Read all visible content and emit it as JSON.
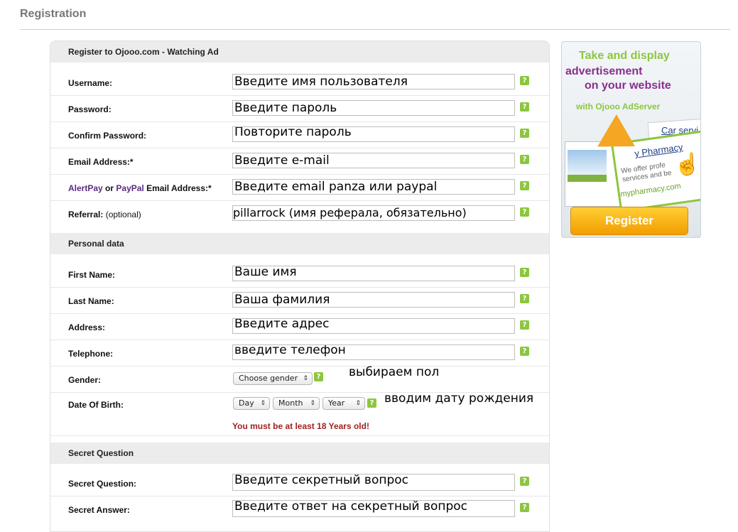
{
  "page": {
    "title": "Registration"
  },
  "form": {
    "header": "Register to Ojooo.com - Watching Ad",
    "account": {
      "username": {
        "label": "Username:",
        "value": "Введите имя пользователя"
      },
      "password": {
        "label": "Password:",
        "value": "Введите пароль"
      },
      "confirm_password": {
        "label": "Confirm Password:",
        "value": "Повторите пароль"
      },
      "email": {
        "label": "Email Address:*",
        "value": "Введите e-mail"
      },
      "pay_email": {
        "alertpay": "AlertPay",
        "or": "or",
        "paypal": "PayPal",
        "rest": "Email Address:*",
        "value": "Введите email panza или paypal"
      },
      "referral": {
        "label": "Referral:",
        "optional": "(optional)",
        "value": "pillarrock (имя реферала, обязательно)"
      }
    },
    "personal": {
      "header": "Personal data",
      "first_name": {
        "label": "First Name:",
        "value": "Ваше имя"
      },
      "last_name": {
        "label": "Last Name:",
        "value": "Ваша фамилия"
      },
      "address": {
        "label": "Address:",
        "value": "Введите адрес"
      },
      "telephone": {
        "label": "Telephone:",
        "value": "введите телефон"
      },
      "gender": {
        "label": "Gender:",
        "selected": "Choose gender",
        "note": "выбираем пол"
      },
      "dob": {
        "label": "Date Of Birth:",
        "day": "Day",
        "month": "Month",
        "year": "Year",
        "note": "вводим дату рождения",
        "error": "You must be at least 18 Years old!"
      }
    },
    "secret": {
      "header": "Secret Question",
      "question": {
        "label": "Secret Question:",
        "value": "Введите секретный вопрос"
      },
      "answer": {
        "label": "Secret Answer:",
        "value": "Введите ответ на секретный вопрос"
      }
    },
    "help_glyph": "?"
  },
  "ad": {
    "line1": "Take and display",
    "line2": "advertisement",
    "line3": "on your website",
    "line4": "with Ojooo AdServer",
    "car": "Car servi",
    "pharmacy": "y Pharmacy",
    "offer1": "We offer profe",
    "offer2": "services and be",
    "site": "mypharmacy.com",
    "button": "Register"
  }
}
